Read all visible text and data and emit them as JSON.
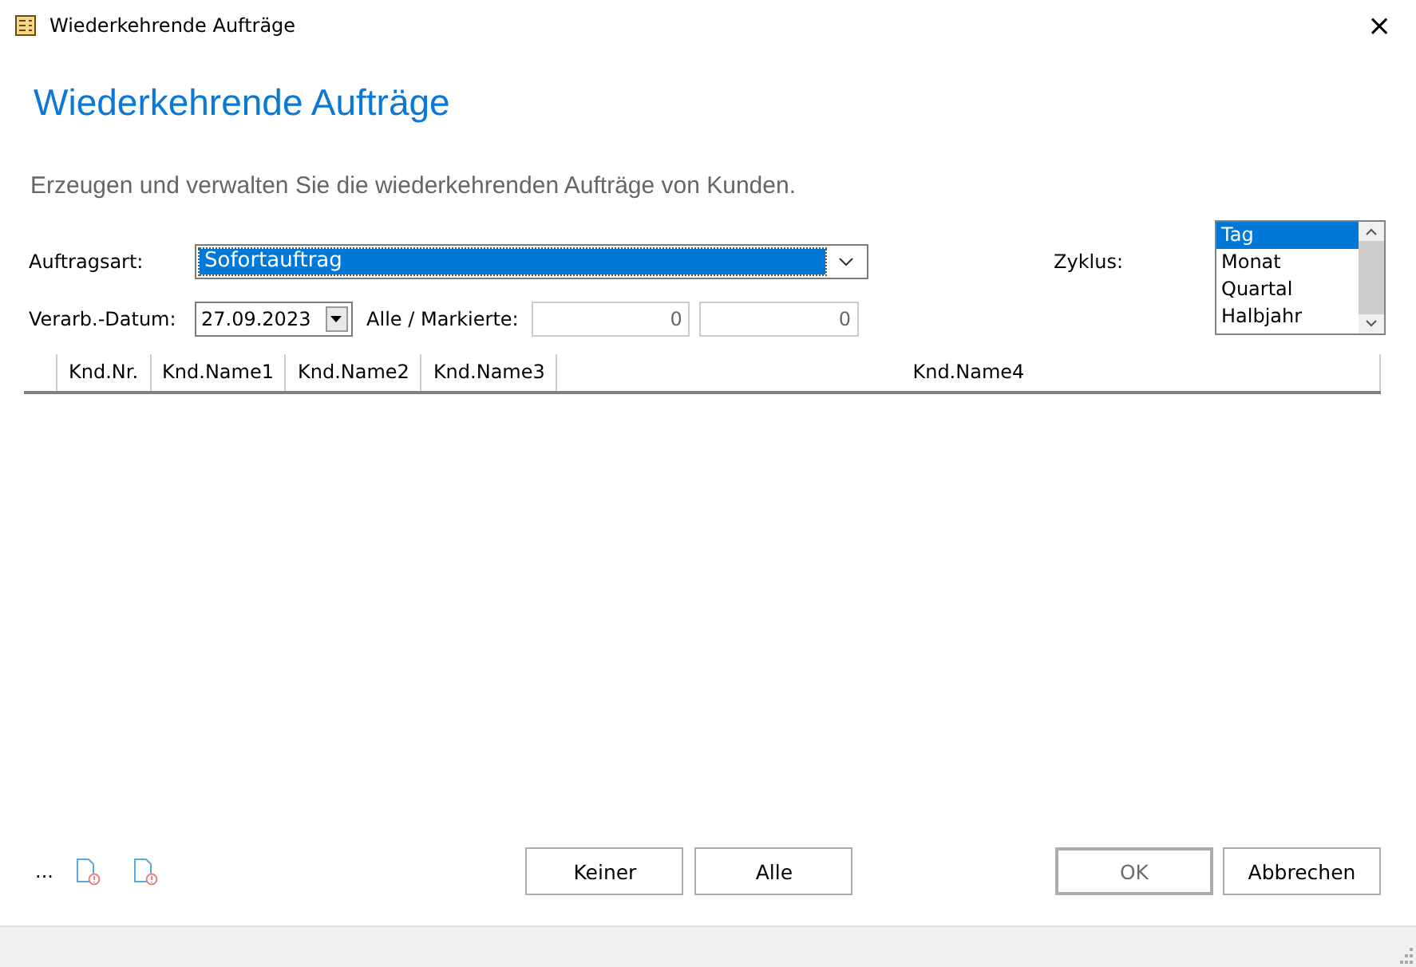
{
  "window": {
    "title": "Wiederkehrende Aufträge",
    "close": "×"
  },
  "heading": "Wiederkehrende Aufträge",
  "description": "Erzeugen und verwalten Sie die wiederkehrenden Aufträge von Kunden.",
  "order_type": {
    "label": "Auftragsart:",
    "value": "Sofortauftrag"
  },
  "date": {
    "label": "Verarb.-Datum:",
    "value": "27.09.2023"
  },
  "counts": {
    "label": "Alle / Markierte:",
    "all": "0",
    "marked": "0"
  },
  "cycle": {
    "label": "Zyklus:",
    "items": [
      {
        "label": "Tag",
        "selected": true
      },
      {
        "label": "Monat",
        "selected": false
      },
      {
        "label": "Quartal",
        "selected": false
      },
      {
        "label": "Halbjahr",
        "selected": false
      }
    ]
  },
  "table": {
    "columns": [
      "Knd.Nr.",
      "Knd.Name1",
      "Knd.Name2",
      "Knd.Name3",
      "Knd.Name4"
    ]
  },
  "footer": {
    "more": "...",
    "buttons": [
      {
        "label": "Keiner",
        "disabled": false
      },
      {
        "label": "Alle",
        "disabled": false
      }
    ],
    "dialog_buttons": [
      {
        "label": "OK",
        "disabled": true
      },
      {
        "label": "Abbrechen",
        "disabled": false
      }
    ]
  }
}
